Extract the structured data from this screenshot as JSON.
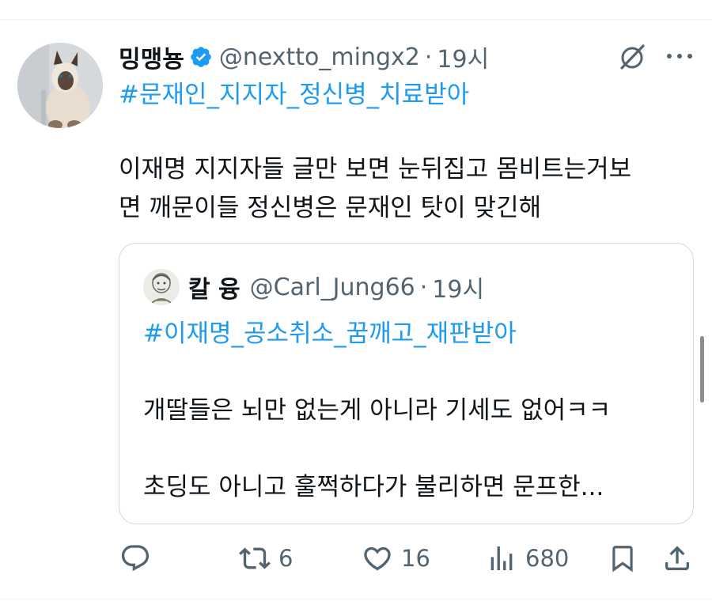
{
  "tweet": {
    "author": {
      "display_name": "밍맹뇽",
      "handle": "@nextto_mingx2",
      "verified": true
    },
    "separator": "·",
    "time": "19시",
    "hashtag": "#문재인_지지자_정신병_치료받아",
    "body_lines": [
      "이재명 지지자들 글만 보면 눈뒤집고 몸비트는거보",
      "면 깨문이들 정신병은 문재인 탓이 맞긴해"
    ],
    "header_icons": [
      "grok-icon",
      "more-icon"
    ]
  },
  "quote": {
    "author": {
      "display_name": "칼 융",
      "handle": "@Carl_Jung66"
    },
    "separator": "·",
    "time": "19시",
    "hashtag": "#이재명_공소취소_꿈깨고_재판받아",
    "lines": [
      "개딸들은 뇌만 없는게 아니라 기세도 없어ㅋㅋ",
      "초딩도 아니고 훌쩍하다가 불리하면 문프한..."
    ]
  },
  "actions": {
    "reply": {
      "icon": "reply-icon",
      "count": ""
    },
    "retweet": {
      "icon": "retweet-icon",
      "count": "6"
    },
    "like": {
      "icon": "heart-icon",
      "count": "16"
    },
    "views": {
      "icon": "views-icon",
      "count": "680"
    },
    "bookmark": {
      "icon": "bookmark-icon"
    },
    "share": {
      "icon": "share-icon"
    }
  },
  "colors": {
    "text": "#0f1419",
    "secondary": "#536471",
    "link": "#1d9bf0",
    "verified": "#1d9bf0",
    "border": "#cfd9de"
  }
}
